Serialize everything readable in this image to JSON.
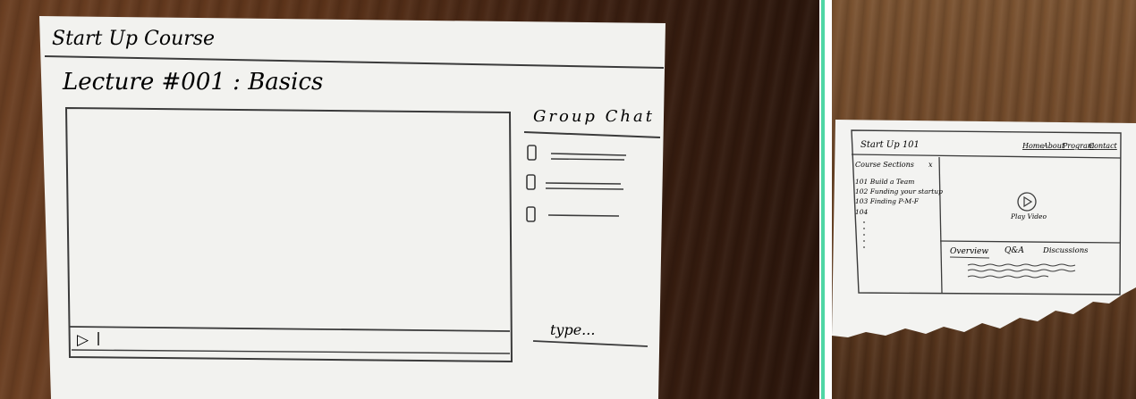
{
  "sketch_left": {
    "app_title": "Start Up Course",
    "lecture_title": "Lecture #001 : Basics",
    "play_glyph": "▷",
    "chat": {
      "title": "Group Chat",
      "items": [
        "",
        "",
        ""
      ],
      "input_placeholder": "type..."
    },
    "icons": {
      "play": "play-icon",
      "chat_avatar": "avatar-placeholder-icon"
    }
  },
  "sketch_right": {
    "app_title": "Start Up 101",
    "nav": [
      "Home",
      "About",
      "Program",
      "Contact"
    ],
    "sidebar": {
      "title": "Course Sections",
      "close": "x",
      "items": [
        "101 Build a Team",
        "102 Funding your startup",
        "103 Finding P-M-F",
        "104"
      ]
    },
    "video": {
      "play_label": "Play Video",
      "icon": "play-circle-icon"
    },
    "tabs": [
      "Overview",
      "Q&A",
      "Discussions"
    ]
  },
  "colors": {
    "pen": "#3b3b3b",
    "paper": "#f2f2ef",
    "divider_accent": "#4fd6a5"
  }
}
